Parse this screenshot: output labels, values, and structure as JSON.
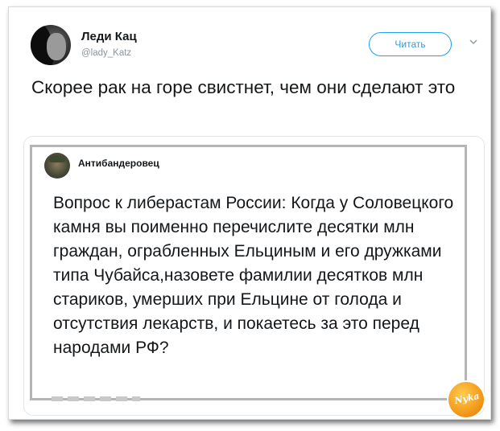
{
  "tweet": {
    "author_name": "Леди Кац",
    "author_handle": "@lady_Katz",
    "follow_label": "Читать",
    "text": "Скорее рак на горе свистнет, чем они сделают это"
  },
  "quoted": {
    "author_name": "Антибандеровец",
    "text": "Вопрос к либерастам России: Когда у Соловецкого камня вы поименно перечислите десятки млн граждан, ограбленных Ельциным и его дружками типа Чубайса,назовете фамилии десятков млн стариков, умерших при Ельцине от голода и отсутствия лекарств, и покаетесь за это перед народами РФ?"
  },
  "watermark": {
    "text": "Nyka"
  },
  "colors": {
    "accent": "#1da1f2",
    "text": "#14171a",
    "muted": "#8a959e"
  },
  "icons": {
    "more": "chevron-down-icon"
  }
}
